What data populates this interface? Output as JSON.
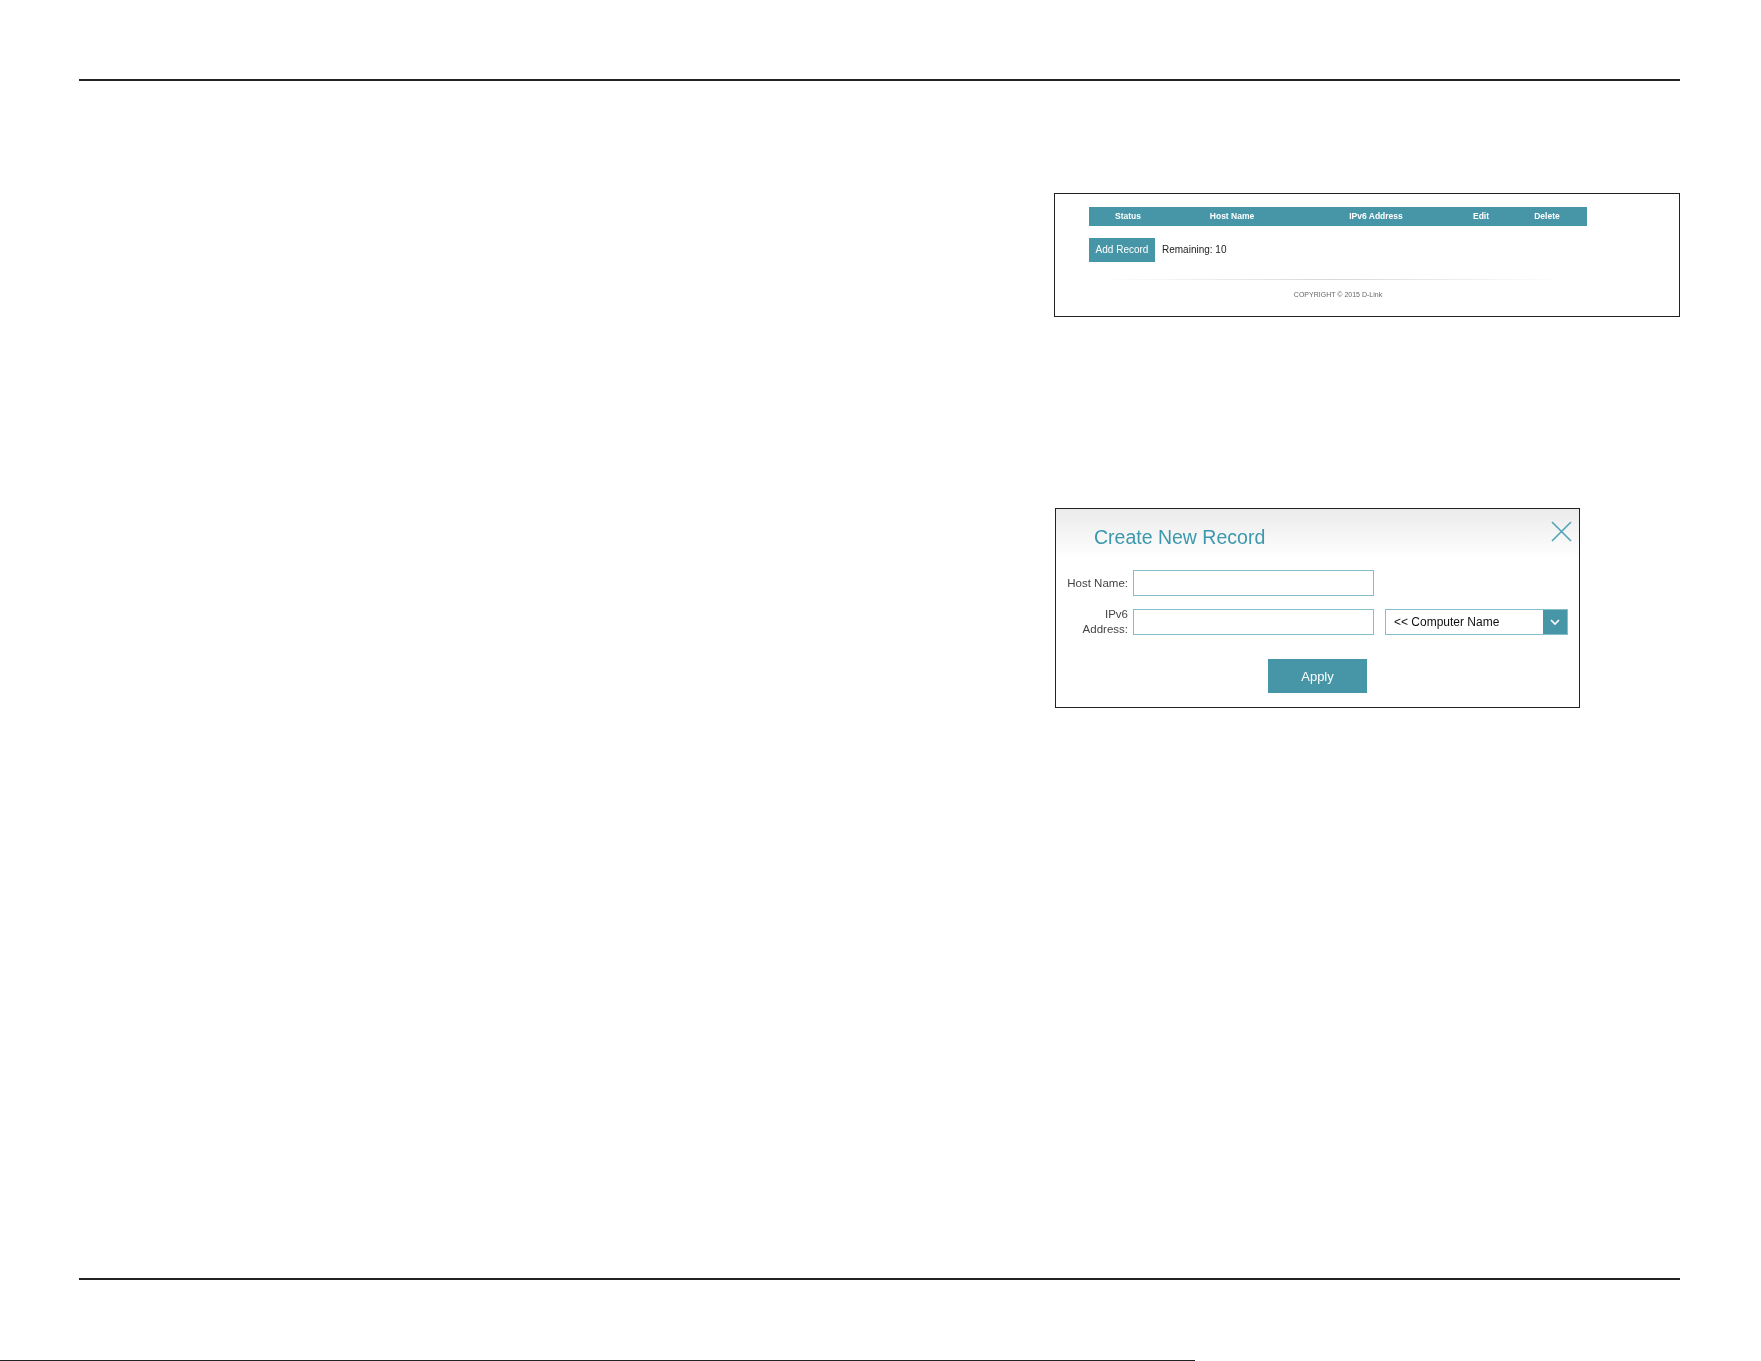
{
  "records_panel": {
    "columns": [
      "Status",
      "Host Name",
      "IPv6 Address",
      "Edit",
      "Delete"
    ],
    "add_button": "Add Record",
    "remaining": "Remaining: 10",
    "copyright": "COPYRIGHT © 2015 D-Link"
  },
  "dialog": {
    "title": "Create New Record",
    "fields": [
      {
        "kind": "text",
        "label": "Host Name:"
      },
      {
        "kind": "text_with_select",
        "label": "IPv6 Address:",
        "select_value": "<< Computer Name"
      }
    ],
    "button": "Apply"
  }
}
